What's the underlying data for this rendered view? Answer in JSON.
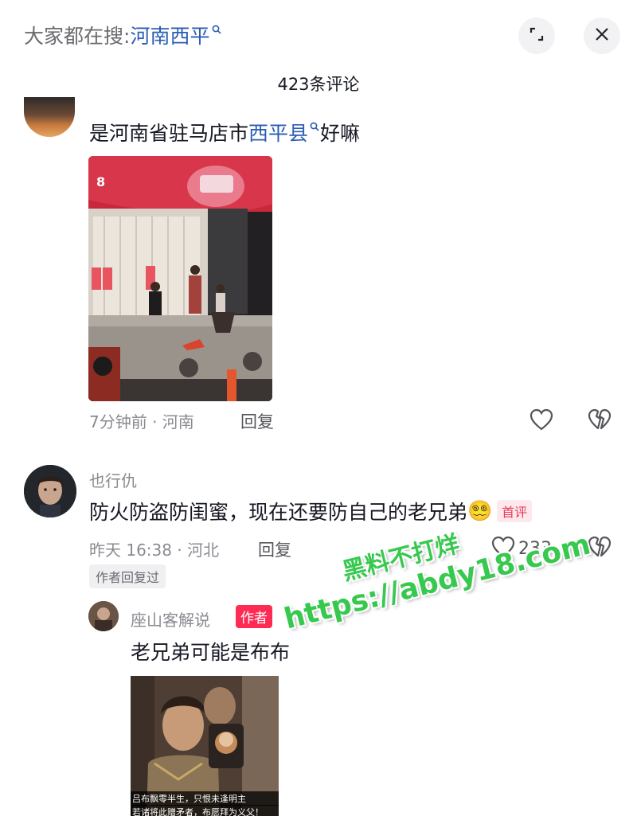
{
  "search_bar": {
    "prefix": "大家都在搜:",
    "keyword": "河南西平",
    "search_icon": "search-icon",
    "expand_icon": "expand-icon",
    "close_icon": "close-icon"
  },
  "comment_count": "423条评论",
  "comments": [
    {
      "text_before": "是河南省驻马店市",
      "keyword": "西平县",
      "text_after": "好嘛",
      "image": "street-night-photo",
      "time_location": "7分钟前 · 河南",
      "reply_label": "回复"
    },
    {
      "username": "也行仇",
      "text": "防火防盗防闺蜜，现在还要防自己的老兄弟",
      "emoji": "😵‍💫",
      "badge": "首评",
      "time_location": "昨天 16:38 · 河北",
      "reply_label": "回复",
      "like_count": "233",
      "author_replied": "作者回复过"
    }
  ],
  "reply": {
    "username": "座山客解说",
    "author_badge": "作者",
    "text": "老兄弟可能是布布",
    "image_caption_1": "吕布飘零半生，只恨未逢明主",
    "image_caption_2": "若诸将此赠矛者，布愿拜为义父！"
  },
  "watermark": {
    "line1": "黑料不打烊",
    "line2": "https://abdy18.com"
  },
  "colors": {
    "keyword_blue": "#2b5db3",
    "badge_red": "#fe2c55",
    "watermark_green": "#37c94e"
  }
}
